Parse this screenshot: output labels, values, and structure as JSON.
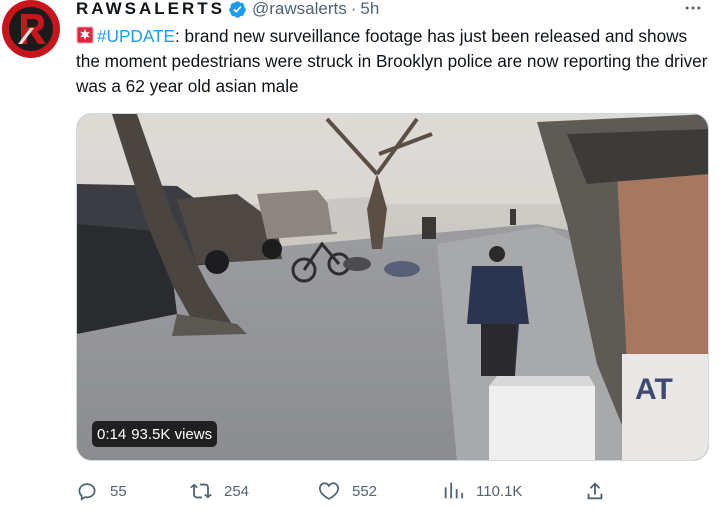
{
  "tweet": {
    "author": {
      "display_name": "RAWSALERTS",
      "handle": "@rawsalerts",
      "verified": true,
      "avatar_colors": {
        "outer": "#c8141c",
        "inner": "#1b1b1b"
      }
    },
    "time_separator": "·",
    "timestamp": "5h",
    "more_icon": "more-icon",
    "text": {
      "emoji": "siren-emoji",
      "hashtag": "#UPDATE",
      "body": ": brand new surveillance footage has just been released and shows the moment pedestrians were struck in Brooklyn police are now reporting the driver was a 62 year old asian male"
    },
    "media": {
      "type": "video",
      "duration": "0:14",
      "views": "93.5K views",
      "sign_text": "AT"
    },
    "actions": {
      "reply": {
        "icon": "reply-icon",
        "count": "55"
      },
      "retweet": {
        "icon": "retweet-icon",
        "count": "254"
      },
      "like": {
        "icon": "heart-icon",
        "count": "552"
      },
      "views": {
        "icon": "views-icon",
        "count": "110.1K"
      },
      "share": {
        "icon": "share-icon"
      }
    },
    "colors": {
      "link": "#1d9bf0",
      "muted": "#536471",
      "text": "#0f1419"
    }
  }
}
